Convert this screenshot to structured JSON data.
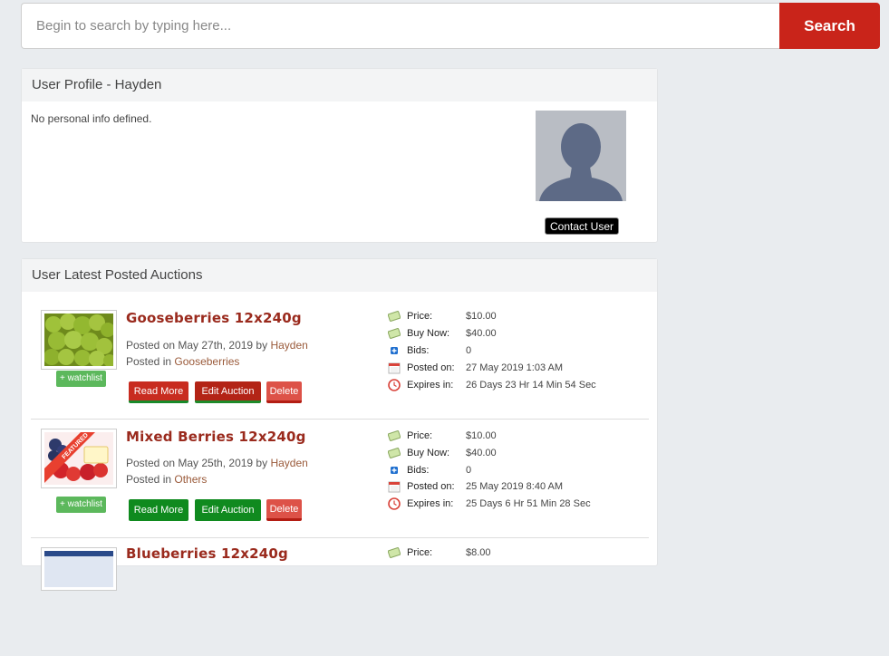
{
  "search": {
    "placeholder": "Begin to search by typing here...",
    "button_label": "Search"
  },
  "profile": {
    "title": "User Profile - Hayden",
    "info_text": "No personal info defined.",
    "contact_label": "Contact User"
  },
  "auctions": {
    "title": "User Latest Posted Auctions",
    "items": [
      {
        "title": "Gooseberries 12x240g",
        "posted_on": "Posted on May 27th, 2019 by",
        "posted_by": "Hayden",
        "posted_in_prefix": "Posted in",
        "category": "Gooseberries",
        "watchlist": "+ watchlist",
        "read_more": "Read More",
        "edit": "Edit Auction",
        "delete": "Delete",
        "labels": {
          "price": "Price:",
          "buy_now": "Buy Now:",
          "bids": "Bids:",
          "posted": "Posted on:",
          "expires": "Expires in:"
        },
        "values": {
          "price": "$10.00",
          "buy_now": "$40.00",
          "bids": "0",
          "posted": "27 May 2019 1:03 AM",
          "expires": "26 Days 23 Hr 14 Min 54 Sec"
        }
      },
      {
        "title": "Mixed Berries 12x240g",
        "posted_on": "Posted on May 25th, 2019 by",
        "posted_by": "Hayden",
        "posted_in_prefix": "Posted in",
        "category": "Others",
        "badge": "FEATURED",
        "watchlist": "+ watchlist",
        "read_more": "Read More",
        "edit": "Edit Auction",
        "delete": "Delete",
        "labels": {
          "price": "Price:",
          "buy_now": "Buy Now:",
          "bids": "Bids:",
          "posted": "Posted on:",
          "expires": "Expires in:"
        },
        "values": {
          "price": "$10.00",
          "buy_now": "$40.00",
          "bids": "0",
          "posted": "25 May 2019 8:40 AM",
          "expires": "25 Days 6 Hr 51 Min 28 Sec"
        }
      },
      {
        "title": "Blueberries 12x240g",
        "labels": {
          "price": "Price:"
        },
        "values": {
          "price": "$8.00"
        }
      }
    ]
  },
  "colors": {
    "accent": "#c9241a",
    "title": "#9a2a1d",
    "watchlist": "#5cb85c"
  }
}
